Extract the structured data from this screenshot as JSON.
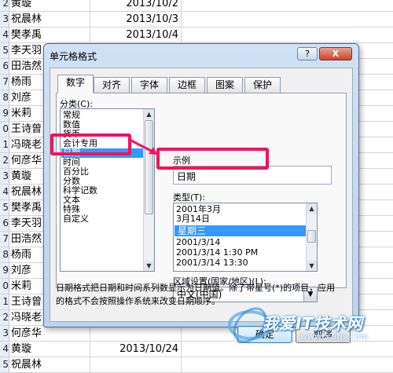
{
  "sheet": {
    "rows": [
      {
        "num": "2",
        "name": "黄璇",
        "date": "2013/10/2"
      },
      {
        "num": "3",
        "name": "祝晨林",
        "date": "2013/10/3"
      },
      {
        "num": "4",
        "name": "樊孝禹",
        "date": "2013/10/4"
      },
      {
        "num": "5",
        "name": "李天羽",
        "date": ""
      },
      {
        "num": "6",
        "name": "田浩然",
        "date": ""
      },
      {
        "num": "7",
        "name": "杨雨",
        "date": ""
      },
      {
        "num": "8",
        "name": "刘彦",
        "date": ""
      },
      {
        "num": "9",
        "name": "米莉",
        "date": ""
      },
      {
        "num": "0",
        "name": "王诗曾",
        "date": ""
      },
      {
        "num": "1",
        "name": "冯晓老",
        "date": ""
      },
      {
        "num": "2",
        "name": "何彦华",
        "date": ""
      },
      {
        "num": "3",
        "name": "黄璇",
        "date": ""
      },
      {
        "num": "4",
        "name": "祝晨林",
        "date": ""
      },
      {
        "num": "5",
        "name": "樊孝禹",
        "date": ""
      },
      {
        "num": "6",
        "name": "李天羽",
        "date": ""
      },
      {
        "num": "7",
        "name": "田浩然",
        "date": ""
      },
      {
        "num": "8",
        "name": "杨雨",
        "date": ""
      },
      {
        "num": "9",
        "name": "刘彦",
        "date": ""
      },
      {
        "num": "0",
        "name": "米莉",
        "date": ""
      },
      {
        "num": "1",
        "name": "王诗曾",
        "date": ""
      },
      {
        "num": "2",
        "name": "冯晓老",
        "date": ""
      },
      {
        "num": "3",
        "name": "何彦华",
        "date": ""
      },
      {
        "num": "4",
        "name": "黄璇",
        "date": "2013/10/24"
      },
      {
        "num": "5",
        "name": "祝晨林",
        "date": ""
      }
    ]
  },
  "dialog": {
    "title": "单元格格式",
    "help": "?",
    "close": "X",
    "tabs": [
      "数字",
      "对齐",
      "字体",
      "边框",
      "图案",
      "保护"
    ],
    "category_label": "分类(C):",
    "categories": [
      "常规",
      "数值",
      "货币",
      "会计专用",
      "日期",
      "时间",
      "百分比",
      "分数",
      "科学记数",
      "文本",
      "特殊",
      "自定义"
    ],
    "selected_category": "日期",
    "sample_label": "示例",
    "sample_value": "日期",
    "type_label": "类型(T):",
    "types": [
      "2001年3月",
      "3月14日",
      "星期三",
      "2001/3/14",
      "2001/3/14 1:30 PM",
      "2001/3/14 13:30"
    ],
    "selected_type": "星期三",
    "locale_label": "区域设置(国家/地区)(L):",
    "locale_value": "中文(中国)",
    "description": "日期格式把日期和时间系列数显示为日期值。除了带星号(*)的项目，应用的格式不会按照操作系统来改变日期顺序。",
    "ok": "确定",
    "cancel": "取消"
  },
  "watermark": {
    "text": "我爱IT技术网",
    "url": "www.52itjs.com"
  },
  "colors": {
    "highlight": "#f0145a",
    "selection": "#3399ff",
    "dialog_frame": "#bcd3ee"
  }
}
